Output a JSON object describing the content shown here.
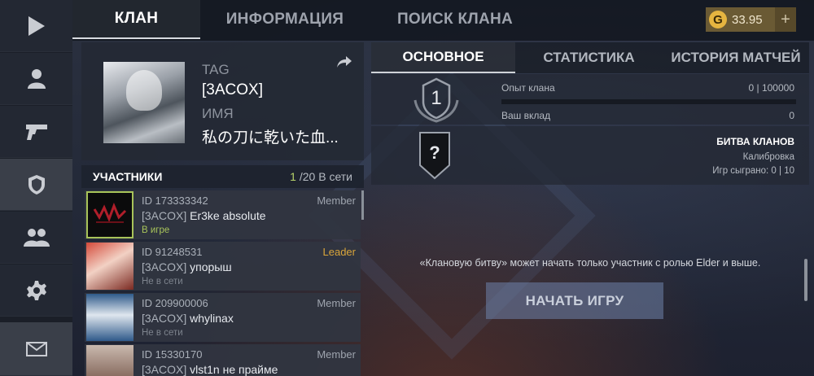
{
  "top_tabs": [
    "КЛАН",
    "ИНФОРМАЦИЯ",
    "ПОИСК КЛАНА"
  ],
  "currency": {
    "value": "33.95",
    "icon": "G",
    "plus": "+"
  },
  "clan": {
    "tag_label": "TAG",
    "tag": "[3ACOX]",
    "name_label": "ИМЯ",
    "name": "私の刀に乾いた血..."
  },
  "members": {
    "title": "УЧАСТНИКИ",
    "online": "1",
    "total": "/20 В сети",
    "list": [
      {
        "id": "ID 173333342",
        "role": "Member",
        "clan": "[3ACOX]",
        "name": "Er3ke absolute",
        "status": "В игре"
      },
      {
        "id": "ID 91248531",
        "role": "Leader",
        "clan": "[3ACOX]",
        "name": "упорыш",
        "status": "Не в сети"
      },
      {
        "id": "ID 209900006",
        "role": "Member",
        "clan": "[3ACOX]",
        "name": "whylinax",
        "status": "Не в сети"
      },
      {
        "id": "ID 15330170",
        "role": "Member",
        "clan": "[3ACOX]",
        "name": "vlst1n не прайме",
        "status": ""
      }
    ]
  },
  "sub_tabs": [
    "ОСНОВНОЕ",
    "СТАТИСТИКА",
    "ИСТОРИЯ МАТЧЕЙ"
  ],
  "rank": {
    "level": "1",
    "exp_label": "Опыт клана",
    "exp_value": "0 | 100000",
    "exp_progress": 0,
    "contrib_label": "Ваш вклад",
    "contrib_value": "0"
  },
  "battle": {
    "icon": "?",
    "title": "БИТВА КЛАНОВ",
    "status": "Калибровка",
    "played": "Игр сыграно: 0 | 10"
  },
  "notice": "«Клановую битву» может начать только участник с ролью Elder и выше.",
  "start_button": "НАЧАТЬ ИГРУ",
  "icons": [
    "play-icon",
    "profile-icon",
    "pistol-icon",
    "clan-emblem-icon",
    "friends-icon",
    "gear-icon",
    "mail-icon",
    "share-icon"
  ],
  "colors": {
    "accent_gold": "#c9a24a",
    "online_green": "#a8c45a",
    "leader_orange": "#d9a53a"
  }
}
